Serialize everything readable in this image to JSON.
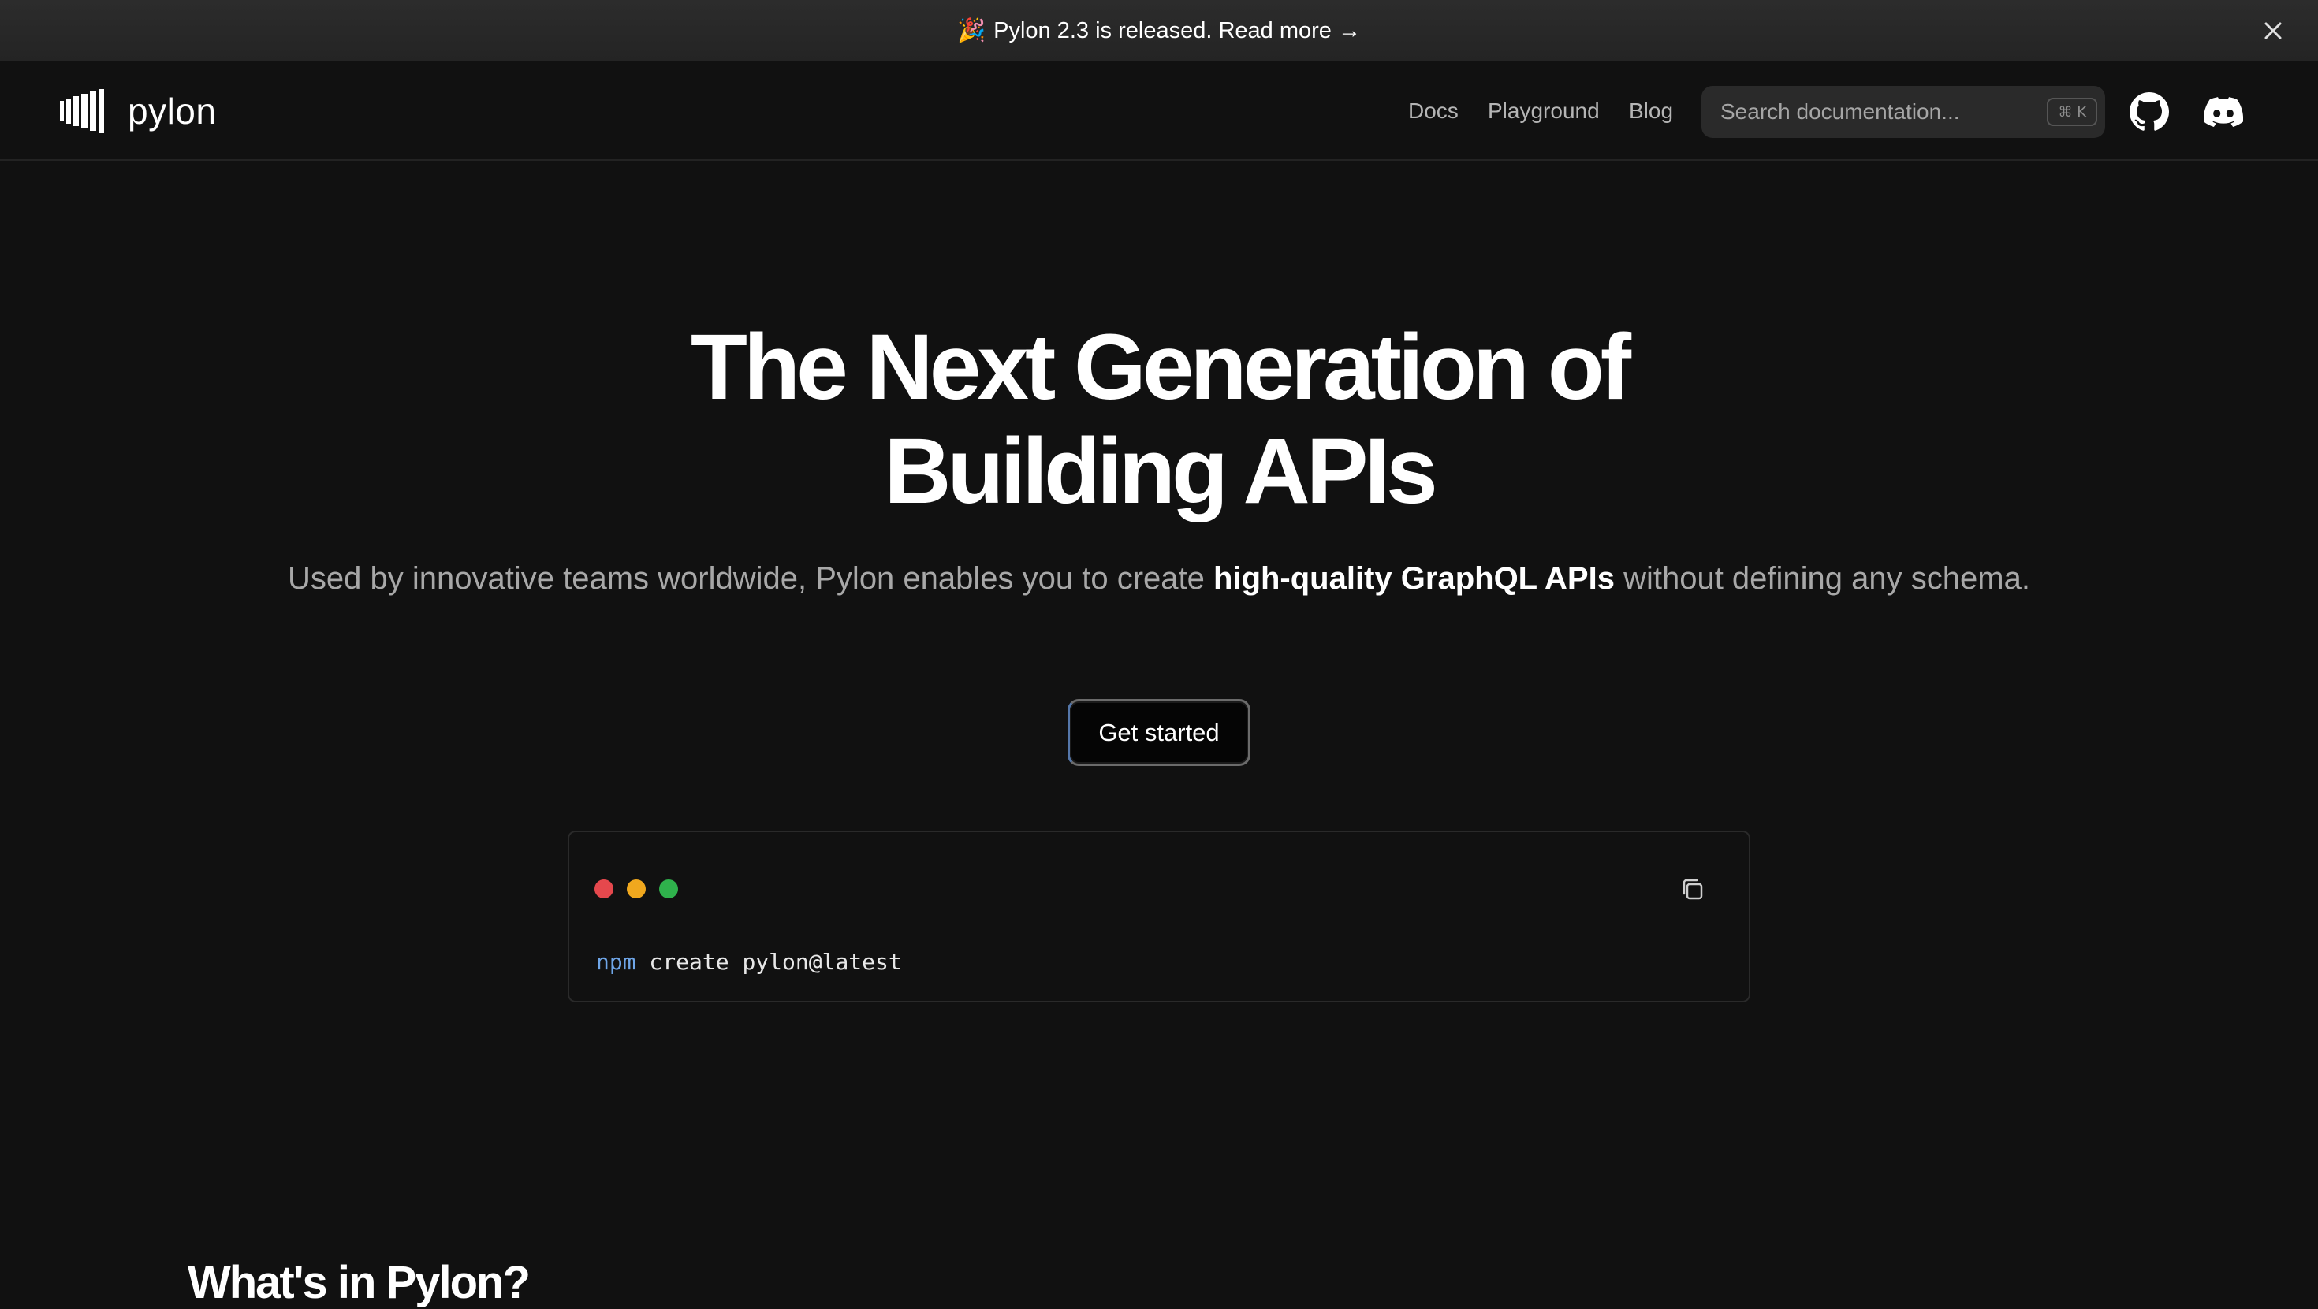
{
  "banner": {
    "emoji": "🎉",
    "text": "Pylon 2.3 is released. Read more →"
  },
  "header": {
    "logo_text": "pylon",
    "nav": {
      "docs": "Docs",
      "playground": "Playground",
      "blog": "Blog"
    },
    "search": {
      "placeholder": "Search documentation...",
      "shortcut": "⌘ K"
    }
  },
  "hero": {
    "title_line1": "The Next Generation of",
    "title_line2": "Building APIs",
    "subtitle_part1": "Used by innovative teams worldwide, Pylon enables you to create ",
    "subtitle_bold": "high-quality GraphQL APIs",
    "subtitle_part2": " without defining any schema.",
    "cta_label": "Get started"
  },
  "terminal": {
    "command_prefix": "npm",
    "command_rest": " create pylon@latest",
    "dot_colors": [
      "#e5484d",
      "#f0a81e",
      "#2fb24c"
    ],
    "prefix_color": "#6fa6e8"
  },
  "section": {
    "title": "What's in Pylon?"
  },
  "icons": {
    "close": "close-icon",
    "logo": "pylon-logo-icon",
    "github": "github-icon",
    "discord": "discord-icon",
    "copy": "copy-icon"
  }
}
